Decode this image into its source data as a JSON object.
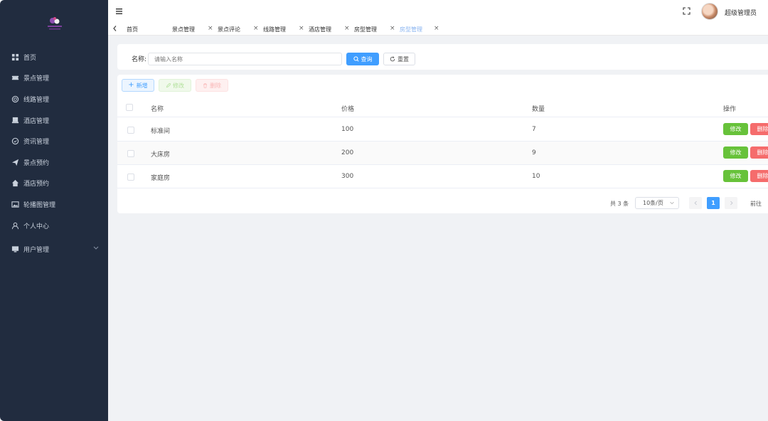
{
  "sidebar": {
    "items": [
      {
        "label": "首页",
        "icon": "dashboard-icon"
      },
      {
        "label": "景点管理",
        "icon": "ticket-icon"
      },
      {
        "label": "线路管理",
        "icon": "route-icon"
      },
      {
        "label": "酒店管理",
        "icon": "hotel-icon"
      },
      {
        "label": "资讯管理",
        "icon": "news-icon"
      },
      {
        "label": "景点预约",
        "icon": "send-icon"
      },
      {
        "label": "酒店预约",
        "icon": "home-icon"
      },
      {
        "label": "轮播图管理",
        "icon": "image-icon"
      },
      {
        "label": "个人中心",
        "icon": "user-icon"
      },
      {
        "label": "用户管理",
        "icon": "monitor-icon"
      }
    ]
  },
  "header": {
    "username": "超级管理员"
  },
  "tags": [
    {
      "label": "首页",
      "active": false
    },
    {
      "label": "景点管理",
      "active": false
    },
    {
      "label": "景点评论",
      "active": false
    },
    {
      "label": "线路管理",
      "active": false
    },
    {
      "label": "酒店管理",
      "active": false
    },
    {
      "label": "房型管理",
      "active": false
    },
    {
      "label": "房型管理",
      "active": true
    }
  ],
  "search": {
    "label": "名称:",
    "placeholder": "请输入名称",
    "search_btn": "查询",
    "reset_btn": "重置"
  },
  "toolbar": {
    "add": "新增",
    "edit": "修改",
    "delete": "删除"
  },
  "table": {
    "columns": [
      "名称",
      "价格",
      "数量",
      "操作"
    ],
    "rows": [
      {
        "name": "标准间",
        "price": "100",
        "qty": "7"
      },
      {
        "name": "大床房",
        "price": "200",
        "qty": "9"
      },
      {
        "name": "家庭房",
        "price": "300",
        "qty": "10"
      }
    ],
    "row_edit": "修改",
    "row_delete": "删除"
  },
  "pagination": {
    "total": "共 3 条",
    "page_size": "10条/页",
    "current_page": "1",
    "goto": "前往"
  },
  "colors": {
    "sidebar_bg": "#212c3f",
    "primary": "#409eff",
    "success": "#67c23a",
    "danger": "#f56c6c"
  }
}
